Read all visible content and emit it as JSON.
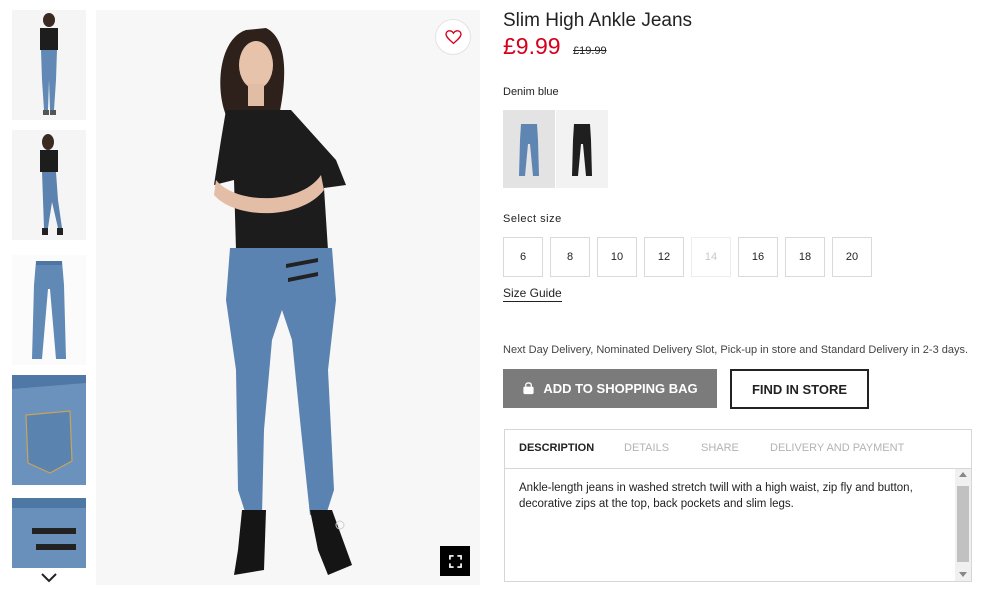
{
  "product": {
    "title": "Slim High Ankle Jeans",
    "price": "£9.99",
    "old_price": "£19.99",
    "color_name": "Denim blue",
    "swatches": [
      {
        "name": "Denim blue",
        "color": "#5f86b3"
      },
      {
        "name": "Black",
        "color": "#1f1f1f"
      }
    ]
  },
  "size_select": {
    "label": "Select size",
    "sizes": [
      {
        "label": "6",
        "available": true
      },
      {
        "label": "8",
        "available": true
      },
      {
        "label": "10",
        "available": true
      },
      {
        "label": "12",
        "available": true
      },
      {
        "label": "14",
        "available": false
      },
      {
        "label": "16",
        "available": true
      },
      {
        "label": "18",
        "available": true
      },
      {
        "label": "20",
        "available": true
      }
    ],
    "guide_label": "Size Guide"
  },
  "delivery_text": "Next Day Delivery, Nominated Delivery Slot, Pick-up in store and Standard Delivery in 2-3 days.",
  "actions": {
    "add_to_bag": "ADD TO SHOPPING BAG",
    "find_in_store": "FIND IN STORE",
    "add_to_bag_icon": "bag-icon"
  },
  "tabs": [
    {
      "label": "DESCRIPTION",
      "active": true
    },
    {
      "label": "DETAILS",
      "active": false
    },
    {
      "label": "SHARE",
      "active": false
    },
    {
      "label": "DELIVERY AND PAYMENT",
      "active": false
    }
  ],
  "description": "Ankle-length jeans in washed stretch twill with a high waist, zip fly and button, decorative zips at the top, back pockets and slim legs.",
  "icons": {
    "favourite": "heart-icon",
    "fullscreen": "fullscreen-icon",
    "thumb_next": "chevron-down-icon"
  },
  "colors": {
    "price_red": "#d6001c",
    "add_bag_bg": "#7b7b7b",
    "denim": "#5f86b3"
  }
}
